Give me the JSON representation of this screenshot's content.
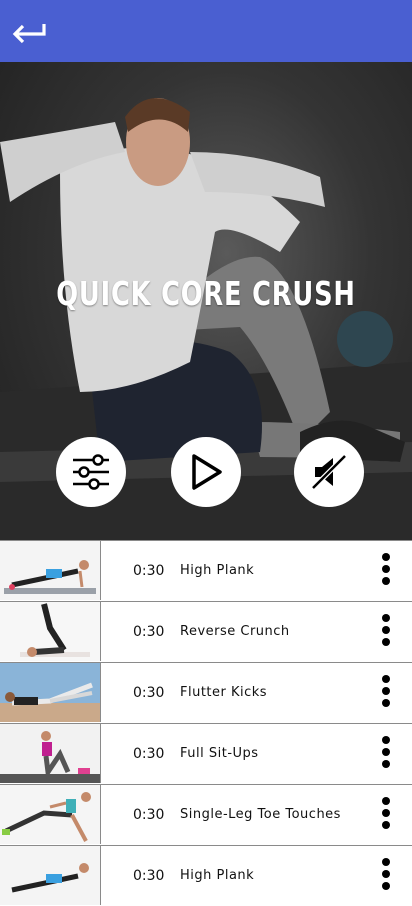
{
  "header": {
    "back_icon": "back-arrow-icon",
    "background": "#4a5fd1"
  },
  "hero": {
    "title": "QUICK CORE CRUSH",
    "controls": [
      {
        "name": "settings-sliders-icon"
      },
      {
        "name": "play-icon"
      },
      {
        "name": "mute-icon"
      }
    ]
  },
  "exercises": [
    {
      "duration": "0:30",
      "name": "High Plank"
    },
    {
      "duration": "0:30",
      "name": "Reverse Crunch"
    },
    {
      "duration": "0:30",
      "name": "Flutter Kicks"
    },
    {
      "duration": "0:30",
      "name": "Full Sit-Ups"
    },
    {
      "duration": "0:30",
      "name": "Single-Leg Toe Touches"
    },
    {
      "duration": "0:30",
      "name": "High Plank"
    }
  ]
}
